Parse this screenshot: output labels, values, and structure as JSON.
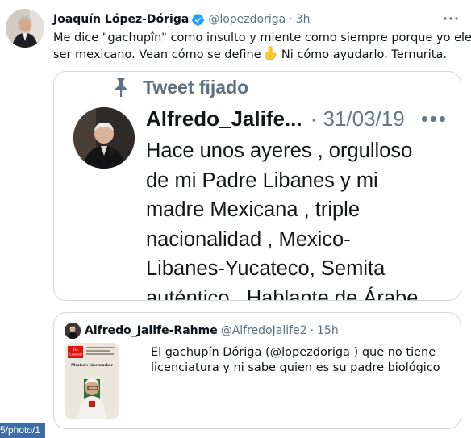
{
  "tweet": {
    "author_name": "Joaquín López-Dóriga",
    "handle": "@lopezdoriga",
    "separator": "·",
    "time": "3h",
    "text_line1": "Me dice \"gachupîn\" como insulto y miente como siempre porque yo elegí",
    "text_line2_before": "ser mexicano. Vean cómo se define",
    "text_line2_after": "Ni cómo ayudarlo. Ternurita."
  },
  "embedded_image": {
    "pinned_label": "Tweet fijado",
    "name": "Alfredo_Jalife...",
    "date": "· 31/03/19",
    "more": "•••",
    "lines": [
      "Hace unos ayeres , orgulloso",
      "de mi Padre Libanes y mi",
      "madre Mexicana , triple",
      "nacionalidad , Mexico-",
      "Libanes-Yucateco, Semita",
      "auténtico , Hablante de Árabe"
    ]
  },
  "quote": {
    "name": "Alfredo_Jalife-Rahme",
    "handle": "@AlfredoJalife2",
    "separator": "·",
    "time": "15h",
    "text": "El gachupín Dóriga (@lopezdoriga )  que no tiene licenciatura y ni sabe quien es su padre biológico",
    "thumb_title_1": "The",
    "thumb_title_2": "Economist",
    "thumb_caption": "Mexico's fake teacher"
  },
  "url_badge": "5/photo/1",
  "colors": {
    "verified": "#1da1f2",
    "secondary_text": "#5b7083",
    "economist_red": "#e3120b"
  },
  "icons": [
    "verified-badge-icon",
    "more-icon",
    "pin-icon",
    "pointing-down-emoji"
  ]
}
